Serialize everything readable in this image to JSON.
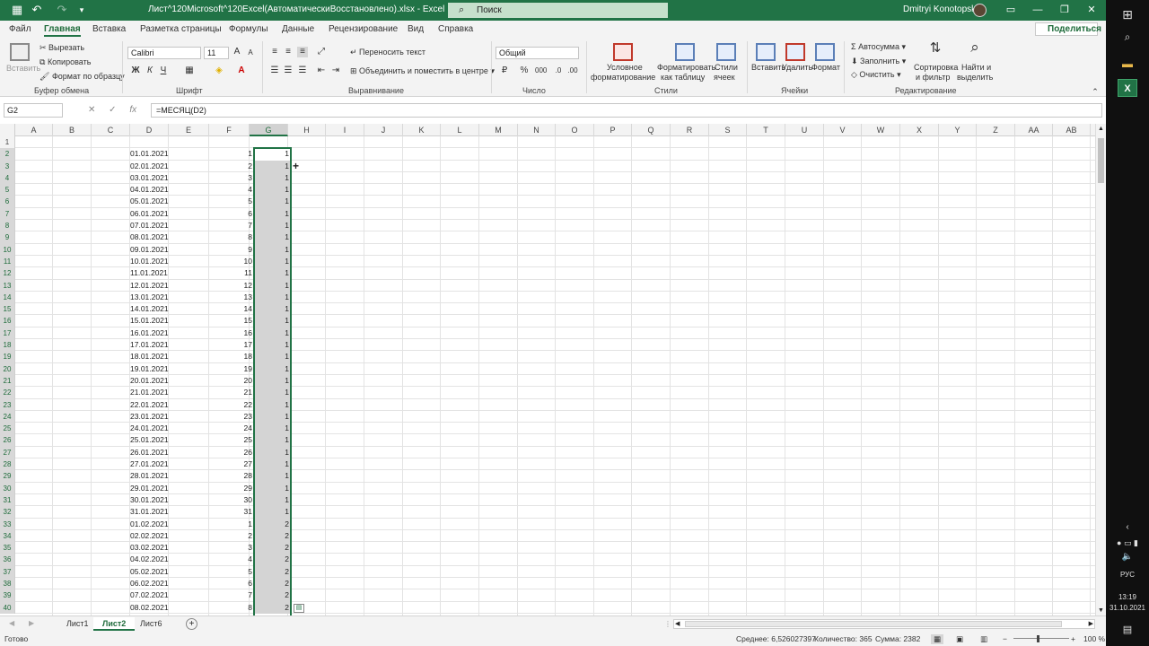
{
  "titlebar": {
    "title": "Лист^120Microsoft^120Excel(АвтоматическиВосстановлено).xlsx  -  Excel",
    "search_placeholder": "Поиск",
    "user": "Dmitryi Konotopskyi",
    "accent": "#217346"
  },
  "tabs": [
    "Файл",
    "Главная",
    "Вставка",
    "Разметка страницы",
    "Формулы",
    "Данные",
    "Рецензирование",
    "Вид",
    "Справка"
  ],
  "share_label": "Поделиться",
  "ribbon": {
    "paste": "Вставить",
    "cut": "Вырезать",
    "copy": "Копировать",
    "format_painter": "Формат по образцу",
    "clipboard_group": "Буфер обмена",
    "font_name": "Calibri",
    "font_size": "11",
    "font_group": "Шрифт",
    "wrap_text": "Переносить текст",
    "merge_center": "Объединить и поместить в центре",
    "align_group": "Выравнивание",
    "number_format": "Общий",
    "number_group": "Число",
    "cond_format_1": "Условное",
    "cond_format_2": "форматирование",
    "format_table_1": "Форматировать",
    "format_table_2": "как таблицу",
    "cell_styles_1": "Стили",
    "cell_styles_2": "ячеек",
    "styles_group": "Стили",
    "insert": "Вставить",
    "delete": "Удалить",
    "format": "Формат",
    "cells_group": "Ячейки",
    "autosum": "Автосумма",
    "fill": "Заполнить",
    "clear": "Очистить",
    "sort_1": "Сортировка",
    "sort_2": "и фильтр",
    "find_1": "Найти и",
    "find_2": "выделить",
    "editing_group": "Редактирование"
  },
  "formula_bar": {
    "name_box": "G2",
    "formula": "=МЕСЯЦ(D2)"
  },
  "columns": [
    "A",
    "B",
    "C",
    "D",
    "E",
    "F",
    "G",
    "H",
    "I",
    "J",
    "K",
    "L",
    "M",
    "N",
    "O",
    "P",
    "Q",
    "R",
    "S",
    "T",
    "U",
    "V",
    "W",
    "X",
    "Y",
    "Z",
    "AA",
    "AB"
  ],
  "rows": [
    {
      "n": "1",
      "d": "",
      "f": "",
      "g": ""
    },
    {
      "n": "2",
      "d": "01.01.2021",
      "f": "1",
      "g": "1"
    },
    {
      "n": "3",
      "d": "02.01.2021",
      "f": "2",
      "g": "1"
    },
    {
      "n": "4",
      "d": "03.01.2021",
      "f": "3",
      "g": "1"
    },
    {
      "n": "5",
      "d": "04.01.2021",
      "f": "4",
      "g": "1"
    },
    {
      "n": "6",
      "d": "05.01.2021",
      "f": "5",
      "g": "1"
    },
    {
      "n": "7",
      "d": "06.01.2021",
      "f": "6",
      "g": "1"
    },
    {
      "n": "8",
      "d": "07.01.2021",
      "f": "7",
      "g": "1"
    },
    {
      "n": "9",
      "d": "08.01.2021",
      "f": "8",
      "g": "1"
    },
    {
      "n": "10",
      "d": "09.01.2021",
      "f": "9",
      "g": "1"
    },
    {
      "n": "11",
      "d": "10.01.2021",
      "f": "10",
      "g": "1"
    },
    {
      "n": "12",
      "d": "11.01.2021",
      "f": "11",
      "g": "1"
    },
    {
      "n": "13",
      "d": "12.01.2021",
      "f": "12",
      "g": "1"
    },
    {
      "n": "14",
      "d": "13.01.2021",
      "f": "13",
      "g": "1"
    },
    {
      "n": "15",
      "d": "14.01.2021",
      "f": "14",
      "g": "1"
    },
    {
      "n": "16",
      "d": "15.01.2021",
      "f": "15",
      "g": "1"
    },
    {
      "n": "17",
      "d": "16.01.2021",
      "f": "16",
      "g": "1"
    },
    {
      "n": "18",
      "d": "17.01.2021",
      "f": "17",
      "g": "1"
    },
    {
      "n": "19",
      "d": "18.01.2021",
      "f": "18",
      "g": "1"
    },
    {
      "n": "20",
      "d": "19.01.2021",
      "f": "19",
      "g": "1"
    },
    {
      "n": "21",
      "d": "20.01.2021",
      "f": "20",
      "g": "1"
    },
    {
      "n": "22",
      "d": "21.01.2021",
      "f": "21",
      "g": "1"
    },
    {
      "n": "23",
      "d": "22.01.2021",
      "f": "22",
      "g": "1"
    },
    {
      "n": "24",
      "d": "23.01.2021",
      "f": "23",
      "g": "1"
    },
    {
      "n": "25",
      "d": "24.01.2021",
      "f": "24",
      "g": "1"
    },
    {
      "n": "26",
      "d": "25.01.2021",
      "f": "25",
      "g": "1"
    },
    {
      "n": "27",
      "d": "26.01.2021",
      "f": "26",
      "g": "1"
    },
    {
      "n": "28",
      "d": "27.01.2021",
      "f": "27",
      "g": "1"
    },
    {
      "n": "29",
      "d": "28.01.2021",
      "f": "28",
      "g": "1"
    },
    {
      "n": "30",
      "d": "29.01.2021",
      "f": "29",
      "g": "1"
    },
    {
      "n": "31",
      "d": "30.01.2021",
      "f": "30",
      "g": "1"
    },
    {
      "n": "32",
      "d": "31.01.2021",
      "f": "31",
      "g": "1"
    },
    {
      "n": "33",
      "d": "01.02.2021",
      "f": "1",
      "g": "2"
    },
    {
      "n": "34",
      "d": "02.02.2021",
      "f": "2",
      "g": "2"
    },
    {
      "n": "35",
      "d": "03.02.2021",
      "f": "3",
      "g": "2"
    },
    {
      "n": "36",
      "d": "04.02.2021",
      "f": "4",
      "g": "2"
    },
    {
      "n": "37",
      "d": "05.02.2021",
      "f": "5",
      "g": "2"
    },
    {
      "n": "38",
      "d": "06.02.2021",
      "f": "6",
      "g": "2"
    },
    {
      "n": "39",
      "d": "07.02.2021",
      "f": "7",
      "g": "2"
    },
    {
      "n": "40",
      "d": "08.02.2021",
      "f": "8",
      "g": "2"
    }
  ],
  "sheets": [
    "Лист1",
    "Лист2",
    "Лист6"
  ],
  "active_sheet": "Лист2",
  "status": {
    "ready": "Готово",
    "average": "Среднее: 6,526027397",
    "count": "Количество: 365",
    "sum": "Сумма: 2382",
    "zoom": "100 %"
  },
  "taskbar": {
    "lang": "РУС",
    "time": "13:19",
    "date": "31.10.2021"
  }
}
